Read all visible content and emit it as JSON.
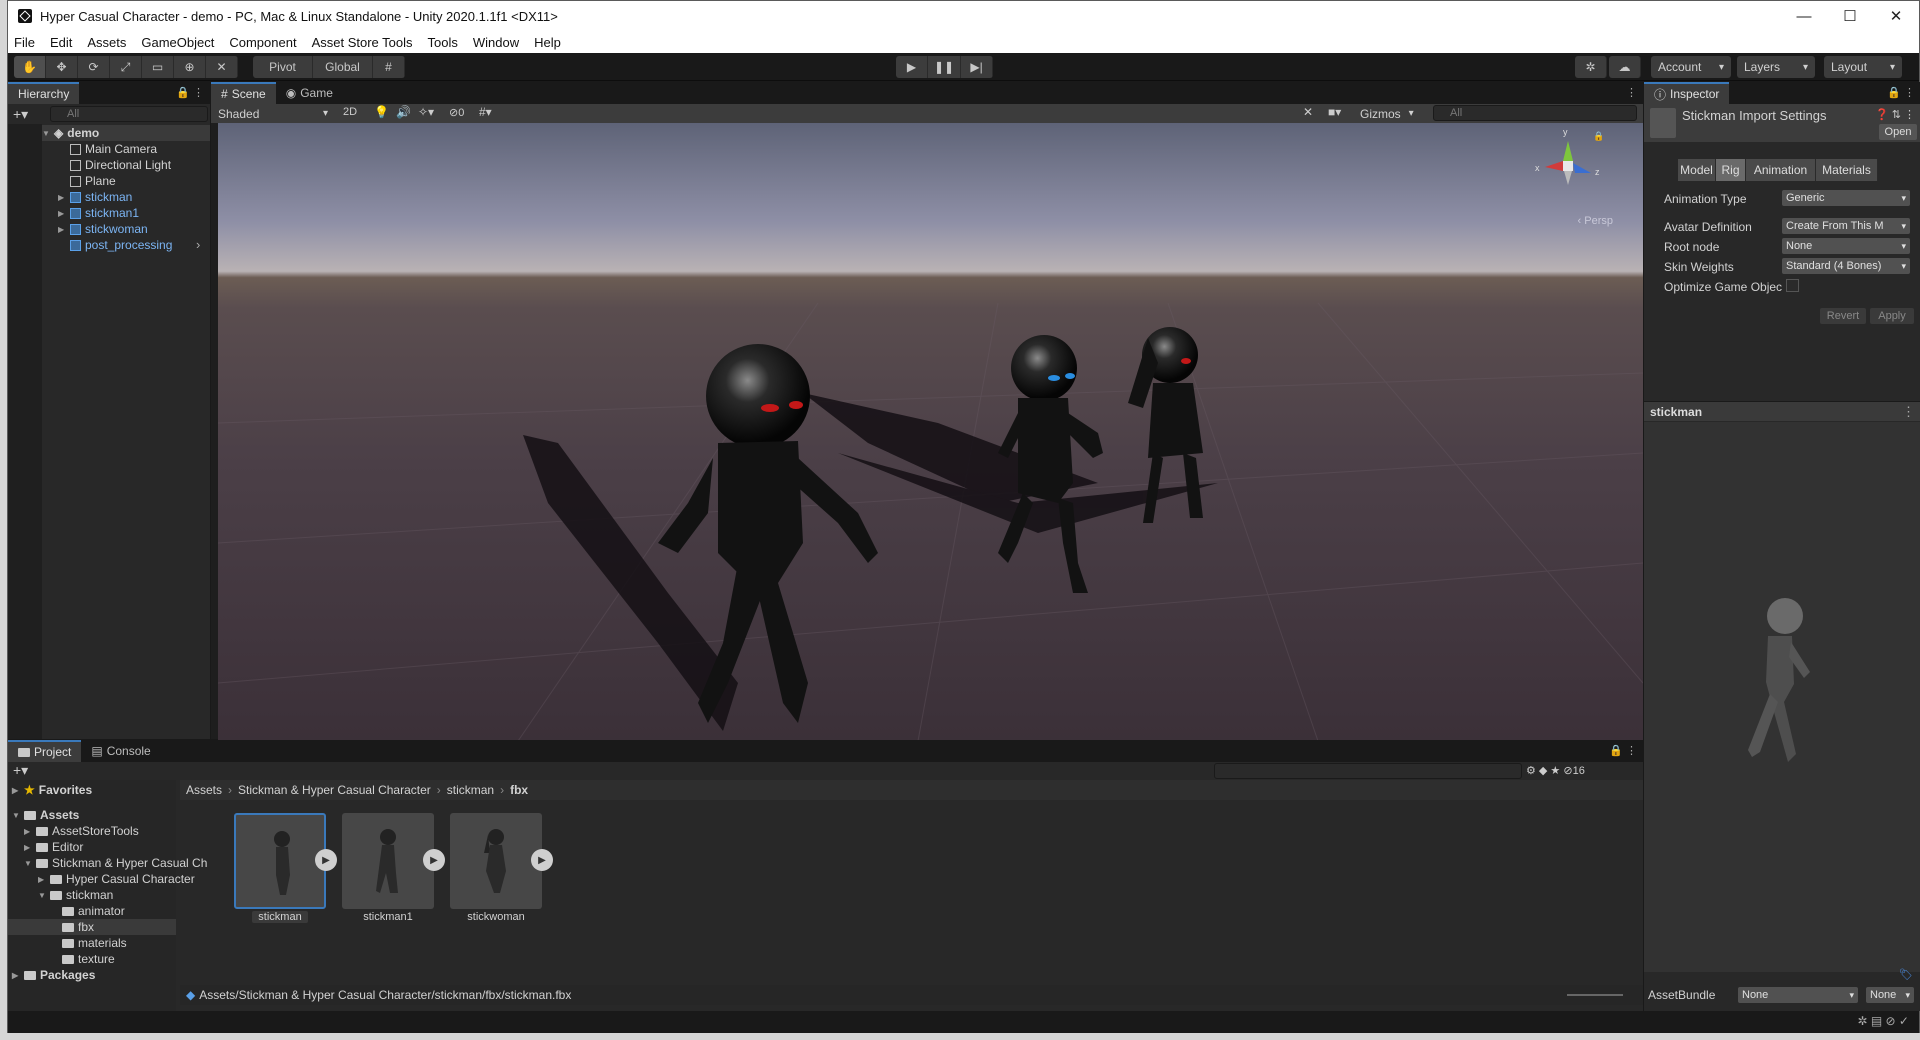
{
  "window": {
    "title": "Hyper Casual Character - demo - PC, Mac & Linux Standalone - Unity 2020.1.1f1 <DX11>",
    "minimize": "—",
    "maximize": "☐",
    "close": "✕"
  },
  "menu": [
    "File",
    "Edit",
    "Assets",
    "GameObject",
    "Component",
    "Asset Store Tools",
    "Tools",
    "Window",
    "Help"
  ],
  "toolbar": {
    "pivot": "Pivot",
    "global": "Global",
    "account": "Account",
    "layers": "Layers",
    "layout": "Layout",
    "play_icon": "play-icon",
    "pause_icon": "pause-icon",
    "step_icon": "step-icon"
  },
  "hierarchy": {
    "tab": "Hierarchy",
    "search_placeholder": "All",
    "scene": "demo",
    "items": [
      "Main Camera",
      "Directional Light",
      "Plane",
      "stickman",
      "stickman1",
      "stickwoman",
      "post_processing"
    ]
  },
  "scene": {
    "tabs": [
      "Scene",
      "Game"
    ],
    "shading": "Shaded",
    "mode2d": "2D",
    "hidden_count": "0",
    "gizmos": "Gizmos",
    "search_placeholder": "All",
    "persp": "Persp",
    "axis_x": "x",
    "axis_y": "y",
    "axis_z": "z"
  },
  "inspector": {
    "tab": "Inspector",
    "title": "Stickman Import Settings",
    "open": "Open",
    "tabs": [
      "Model",
      "Rig",
      "Animation",
      "Materials"
    ],
    "fields": [
      {
        "label": "Animation Type",
        "value": "Generic"
      },
      {
        "label": "Avatar Definition",
        "value": "Create From This M"
      },
      {
        "label": "Root node",
        "value": "None"
      },
      {
        "label": "Skin Weights",
        "value": "Standard (4 Bones)"
      },
      {
        "label": "Optimize Game Objec",
        "value": ""
      }
    ],
    "revert": "Revert",
    "apply": "Apply",
    "preview_title": "stickman",
    "assetbundle_label": "AssetBundle",
    "assetbundle_value": "None",
    "assetbundle_variant": "None"
  },
  "project": {
    "tabs": [
      "Project",
      "Console"
    ],
    "hidden_count": "16",
    "favorites": "Favorites",
    "assets": "Assets",
    "tree": [
      "AssetStoreTools",
      "Editor",
      "Stickman & Hyper Casual Ch",
      "Hyper Casual Character",
      "stickman",
      "animator",
      "fbx",
      "materials",
      "texture"
    ],
    "packages": "Packages",
    "breadcrumb": [
      "Assets",
      "Stickman & Hyper Casual Character",
      "stickman",
      "fbx"
    ],
    "files": [
      "stickman",
      "stickman1",
      "stickwoman"
    ],
    "path": "Assets/Stickman & Hyper Casual Character/stickman/fbx/stickman.fbx"
  }
}
